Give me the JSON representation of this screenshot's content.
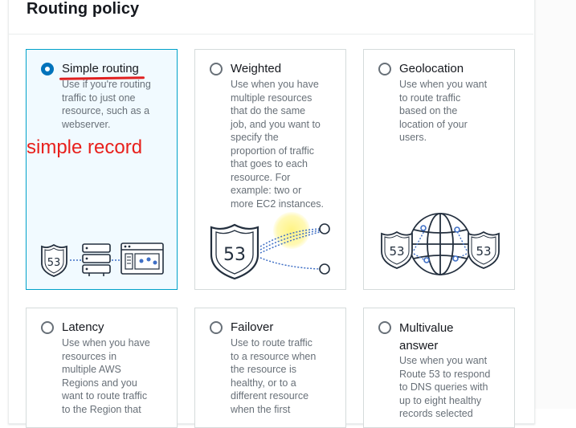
{
  "section": {
    "title": "Routing policy"
  },
  "annotation": {
    "text": "simple record"
  },
  "options": [
    {
      "title": "Simple routing",
      "desc": [
        "Use if you're routing",
        "traffic to just one",
        "resource, such as a",
        "webserver."
      ],
      "selected": true
    },
    {
      "title": "Weighted",
      "desc": [
        "Use when you have",
        "multiple resources",
        "that do the same",
        "job, and you want to",
        "specify the",
        "proportion of traffic",
        "that goes to each",
        "resource. For",
        "example: two or",
        "more EC2 instances."
      ],
      "selected": false
    },
    {
      "title": "Geolocation",
      "desc": [
        "Use when you want",
        "to route traffic",
        "based on the",
        "location of your",
        "users."
      ],
      "selected": false
    },
    {
      "title": "Latency",
      "desc": [
        "Use when you have",
        "resources in",
        "multiple AWS",
        "Regions and you",
        "want to route traffic",
        "to the Region that"
      ],
      "selected": false
    },
    {
      "title": "Failover",
      "desc": [
        "Use to route traffic",
        "to a resource when",
        "the resource is",
        "healthy, or to a",
        "different resource",
        "when the first"
      ],
      "selected": false
    },
    {
      "title": "Multivalue answer",
      "title_lines": [
        "Multivalue",
        "answer"
      ],
      "desc": [
        "Use when you want",
        "Route 53 to respond",
        "to DNS queries with",
        "up to eight healthy",
        "records selected"
      ],
      "selected": false
    }
  ],
  "badge_label": "53",
  "colors": {
    "accent": "#0073bb",
    "selected_border": "#00a1c9",
    "selected_bg": "#f1faff",
    "annotation": "#e8201c"
  }
}
